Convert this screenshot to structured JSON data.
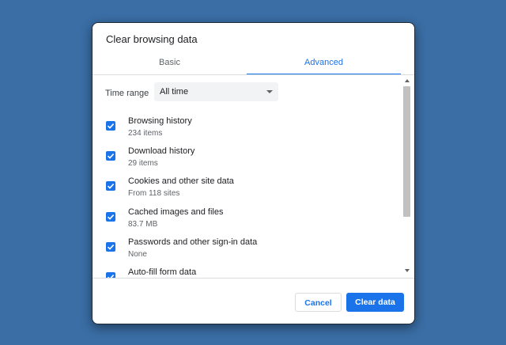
{
  "dialog": {
    "title": "Clear browsing data",
    "tabs": [
      {
        "label": "Basic",
        "active": false
      },
      {
        "label": "Advanced",
        "active": true
      }
    ],
    "time_range": {
      "label": "Time range",
      "value": "All time"
    },
    "items": [
      {
        "label": "Browsing history",
        "sub": "234 items",
        "checked": true
      },
      {
        "label": "Download history",
        "sub": "29 items",
        "checked": true
      },
      {
        "label": "Cookies and other site data",
        "sub": "From 118 sites",
        "checked": true
      },
      {
        "label": "Cached images and files",
        "sub": "83.7 MB",
        "checked": true
      },
      {
        "label": "Passwords and other sign-in data",
        "sub": "None",
        "checked": true
      },
      {
        "label": "Auto-fill form data",
        "sub": "",
        "checked": true
      }
    ],
    "cancel_label": "Cancel",
    "clear_label": "Clear data"
  },
  "colors": {
    "background": "#3a6ea5",
    "accent": "#1a73e8"
  }
}
